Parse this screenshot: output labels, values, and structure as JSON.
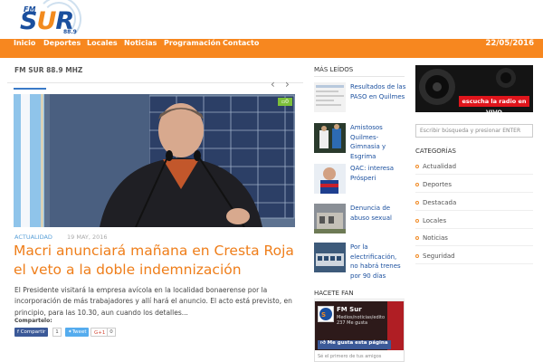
{
  "header": {
    "logo": {
      "fm": "FM",
      "sur_prefix": "S",
      "sur_u": "U",
      "sur_suffix": "R",
      "freq": "88.9"
    }
  },
  "nav": {
    "items": [
      "Inicio",
      "Deportes",
      "Locales",
      "Noticias",
      "Programación",
      "Contacto"
    ],
    "date": "22/05/2016"
  },
  "main": {
    "section_title": "FM SUR 88.9 MHZ",
    "comment_count": "0",
    "category": "ACTUALIDAD",
    "date": "19 MAY, 2016",
    "headline": "Macri anunciará mañana en Cresta Roja el veto a la doble indemnización",
    "excerpt": "El Presidente visitará la empresa avícola en la localidad bonaerense por la incorporación de más trabajadores y allí hará el anuncio. El acto está previsto, en principio, para las 10.30, aun cuando los detalles...",
    "share_label": "Compartelo:",
    "share": {
      "facebook": "Compartir",
      "facebook_count": "1",
      "twitter": "Tweet",
      "google": "G+1",
      "google_count": "0"
    }
  },
  "popular": {
    "title": "MÁS LEÍDOS",
    "items": [
      "Resultados de las PASO en Quilmes",
      "Amistosos Quilmes-Gimnasia y Esgrima",
      "QAC: interesa Prósperi",
      "Denuncia de abuso sexual",
      "Por la electrificación, no habrá trenes por 90 días"
    ]
  },
  "fan": {
    "title": "HACETE FAN",
    "page_name": "FM Sur",
    "subtitle": "Medios/noticias/edito",
    "likes": "237 Me gusta",
    "like_button": "Me gusta esta página",
    "footer": "Sé el primero de tus amigos"
  },
  "sidebar": {
    "radio_banner": "escucha la radio en VIVO",
    "search_placeholder": "Escribir búsqueda y presionar ENTER",
    "categories_title": "CATEGORÍAS",
    "categories": [
      "Actualidad",
      "Deportes",
      "Destacada",
      "Locales",
      "Noticias",
      "Seguridad"
    ]
  },
  "colors": {
    "brand_orange": "#f7871f",
    "brand_blue": "#1a4f9e",
    "link_blue": "#5aa0d8",
    "headline_orange": "#ef7e1a"
  }
}
